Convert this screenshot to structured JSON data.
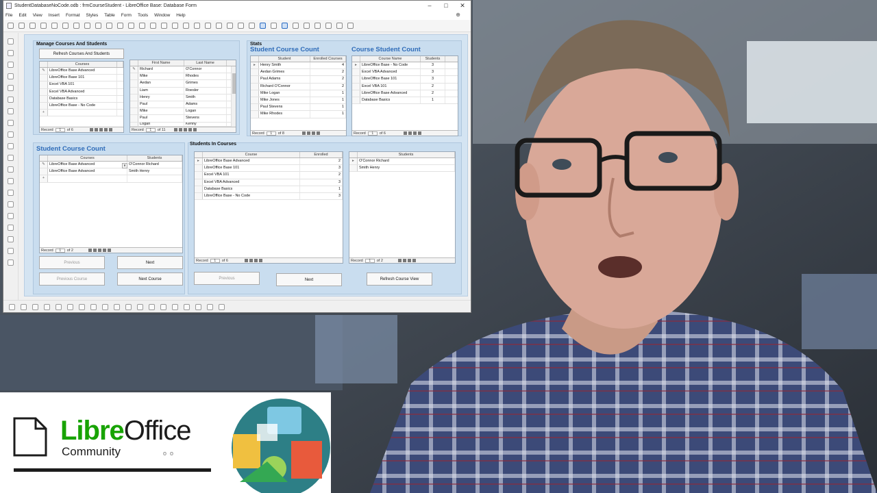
{
  "window": {
    "title": "StudentDatabaseNoCode.odb : frmCourseStudent - LibreOffice Base: Database Form",
    "controls": [
      "–",
      "□",
      "✕"
    ]
  },
  "menu": [
    "File",
    "Edit",
    "View",
    "Insert",
    "Format",
    "Styles",
    "Table",
    "Form",
    "Tools",
    "Window",
    "Help"
  ],
  "manage": {
    "heading": "Manage Courses And Students",
    "refresh_button": "Refresh Courses And Students",
    "courses_header": "Courses",
    "courses": [
      "LibreOffice Base Advanced",
      "LibreOffice Base 101",
      "Excel VBA 101",
      "Excel VBA Advanced",
      "Database Basics",
      "LibreOffice Base - No Code"
    ],
    "courses_nav": {
      "label": "Record",
      "current": "1",
      "of": "of 6"
    },
    "students_headers": [
      "First Name",
      "Last Name"
    ],
    "students": [
      [
        "Richard",
        "O'Connor"
      ],
      [
        "Mike",
        "Rhodes"
      ],
      [
        "Aedan",
        "Grimes"
      ],
      [
        "Liam",
        "Roesler"
      ],
      [
        "Henry",
        "Smith"
      ],
      [
        "Paul",
        "Adams"
      ],
      [
        "Mike",
        "Logan"
      ],
      [
        "Paul",
        "Stevens"
      ],
      [
        "Logan",
        "Kenny"
      ]
    ],
    "students_nav": {
      "label": "Record",
      "current": "1",
      "of": "of 11"
    }
  },
  "stats": {
    "heading": "Stats",
    "scc_title": "Student Course Count",
    "scc_headers": [
      "Student",
      "Enrolled Courses"
    ],
    "scc_rows": [
      [
        "Henry Smith",
        "4"
      ],
      [
        "Aedan Grimes",
        "2"
      ],
      [
        "Paul Adams",
        "2"
      ],
      [
        "Richard O'Connor",
        "2"
      ],
      [
        "Mike Logan",
        "1"
      ],
      [
        "Mike Jones",
        "1"
      ],
      [
        "Paul Stevens",
        "1"
      ],
      [
        "Mike Rhodes",
        "1"
      ]
    ],
    "scc_nav": {
      "label": "Record",
      "current": "1",
      "of": "of 8"
    },
    "csc_title": "Course Student Count",
    "csc_headers": [
      "Course Name",
      "Students"
    ],
    "csc_rows": [
      [
        "LibreOffice Base - No Code",
        "3"
      ],
      [
        "Excel VBA Advanced",
        "3"
      ],
      [
        "LibreOffice Base 101",
        "3"
      ],
      [
        "Excel VBA 101",
        "2"
      ],
      [
        "LibreOffice Base Advanced",
        "2"
      ],
      [
        "Database Basics",
        "1"
      ]
    ],
    "csc_nav": {
      "label": "Record",
      "current": "1",
      "of": "of 6"
    }
  },
  "scc2": {
    "title": "Student Course Count",
    "headers": [
      "Courses",
      "Students"
    ],
    "rows": [
      [
        "LibreOffice Base Advanced",
        "O'Connor Richard"
      ],
      [
        "LibreOffice Base Advanced",
        "Smith Henry"
      ]
    ],
    "nav": {
      "label": "Record",
      "current": "1",
      "of": "of 2"
    },
    "buttons": {
      "previous": "Previous",
      "next": "Next",
      "prev_course": "Previous Course",
      "next_course": "Next Course"
    }
  },
  "sic": {
    "heading": "Students In Courses",
    "headers": [
      "Course",
      "Enrolled"
    ],
    "rows": [
      [
        "LibreOffice Base Advanced",
        "2"
      ],
      [
        "LibreOffice Base 101",
        "3"
      ],
      [
        "Excel VBA 101",
        "2"
      ],
      [
        "Excel VBA Advanced",
        "3"
      ],
      [
        "Database Basics",
        "1"
      ],
      [
        "LibreOffice Base - No Code",
        "3"
      ]
    ],
    "nav": {
      "label": "Record",
      "current": "1",
      "of": "of 6"
    },
    "students_header": "Students",
    "students": [
      "O'Connor Richard",
      "Smith Henry"
    ],
    "students_nav": {
      "label": "Record",
      "current": "1",
      "of": "of 2"
    },
    "buttons": {
      "previous": "Previous",
      "next": "Next",
      "refresh": "Refresh Course View"
    }
  },
  "logo": {
    "word_a": "Libre",
    "word_b": "Office",
    "sub": "Community",
    "dots": "o  o"
  }
}
